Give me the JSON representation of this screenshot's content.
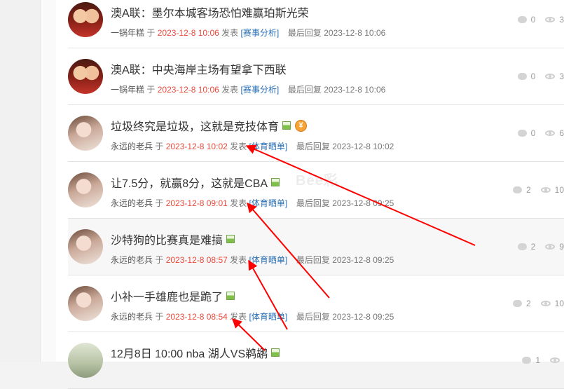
{
  "threads": [
    {
      "title": "澳A联：墨尔本城客场恐怕难赢珀斯光荣",
      "author": "一锅年糕",
      "yu": "于",
      "date": "2023-12-8 10:06",
      "posted": "发表",
      "category": "[赛事分析]",
      "last_reply_label": "最后回复",
      "last_reply": "2023-12-8 10:06",
      "replies": "0",
      "views": "3",
      "avatar": "avatar-cartoon-red",
      "image_icon": false,
      "money_icon": false
    },
    {
      "title": "澳A联：中央海岸主场有望拿下西联",
      "author": "一锅年糕",
      "yu": "于",
      "date": "2023-12-8 10:06",
      "posted": "发表",
      "category": "[赛事分析]",
      "last_reply_label": "最后回复",
      "last_reply": "2023-12-8 10:06",
      "replies": "0",
      "views": "3",
      "avatar": "avatar-cartoon-red",
      "image_icon": false,
      "money_icon": false
    },
    {
      "title": "垃圾终究是垃圾，这就是竞技体育",
      "author": "永远的老兵",
      "yu": "于",
      "date": "2023-12-8 10:02",
      "posted": "发表",
      "category": "[体育晒单]",
      "last_reply_label": "最后回复",
      "last_reply": "2023-12-8 10:02",
      "replies": "0",
      "views": "6",
      "avatar": "avatar-girl",
      "image_icon": true,
      "money_icon": true
    },
    {
      "title": "让7.5分，就赢8分，这就是CBA",
      "author": "永远的老兵",
      "yu": "于",
      "date": "2023-12-8 09:01",
      "posted": "发表",
      "category": "[体育晒单]",
      "last_reply_label": "最后回复",
      "last_reply": "2023-12-8 09:25",
      "replies": "2",
      "views": "10",
      "avatar": "avatar-girl",
      "image_icon": true,
      "money_icon": false
    },
    {
      "title": "沙特狗的比赛真是难搞",
      "author": "永远的老兵",
      "yu": "于",
      "date": "2023-12-8 08:57",
      "posted": "发表",
      "category": "[体育晒单]",
      "last_reply_label": "最后回复",
      "last_reply": "2023-12-8 09:25",
      "replies": "2",
      "views": "9",
      "avatar": "avatar-girl",
      "image_icon": true,
      "money_icon": false
    },
    {
      "title": "小补一手雄鹿也是跪了",
      "author": "永远的老兵",
      "yu": "于",
      "date": "2023-12-8 08:54",
      "posted": "发表",
      "category": "[体育晒单]",
      "last_reply_label": "最后回复",
      "last_reply": "2023-12-8 09:25",
      "replies": "2",
      "views": "10",
      "avatar": "avatar-girl",
      "image_icon": true,
      "money_icon": false
    },
    {
      "title": "12月8日 10:00 nba 湖人VS鹈鹕",
      "author": "",
      "yu": "",
      "date": "",
      "posted": "",
      "category": "",
      "last_reply_label": "",
      "last_reply": "",
      "replies": "1",
      "views": "",
      "avatar": "avatar-court",
      "image_icon": true,
      "money_icon": false
    }
  ],
  "watermark": "Bee彩",
  "colors": {
    "date": "#e94a3c",
    "category": "#2a6fb5",
    "annotation_arrow": "#ff0000"
  },
  "icons": {
    "replies": "comment-bubble-icon",
    "views": "eye-icon",
    "image": "image-attachment-icon",
    "reward": "money-reward-icon"
  }
}
